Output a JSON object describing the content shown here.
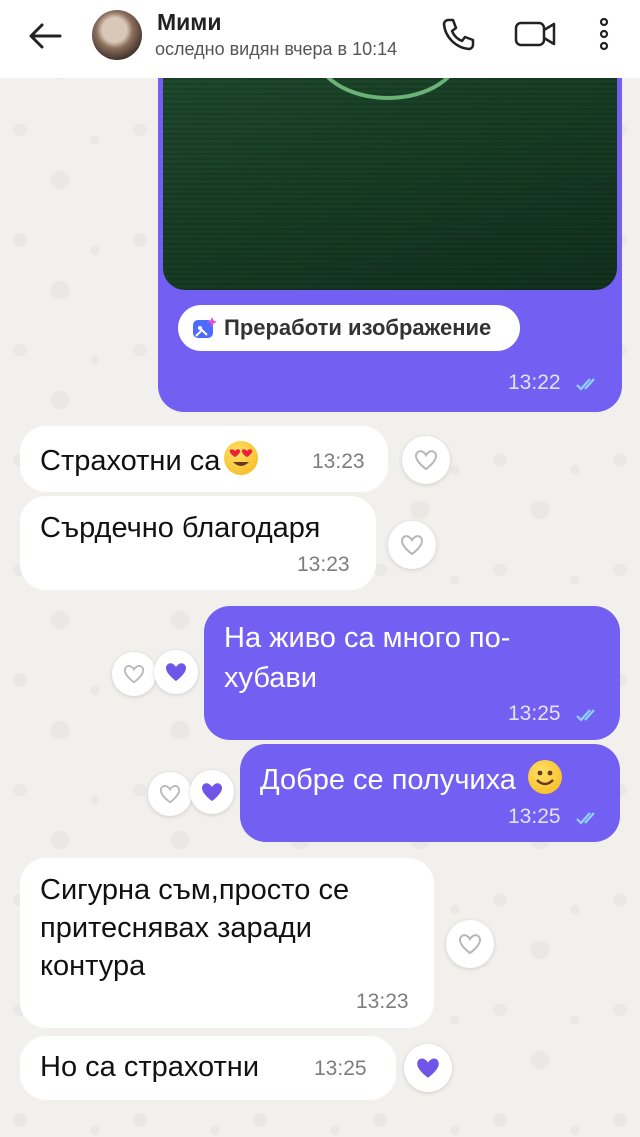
{
  "header": {
    "title": "Мими",
    "status": "оследно видян вчера в 10:14"
  },
  "messages": {
    "image_msg": {
      "action_label": "Преработи изображение",
      "time": "13:22",
      "direction": "outgoing"
    },
    "m1": {
      "text": "Страхотни са",
      "emoji": "heart-eyes-emoji",
      "time": "13:23",
      "direction": "incoming"
    },
    "m2": {
      "text": "Сърдечно благодаря",
      "time": "13:23",
      "direction": "incoming"
    },
    "m3": {
      "line1": "На живо са много по-",
      "line2": "хубави",
      "time": "13:25",
      "direction": "outgoing"
    },
    "m4": {
      "text": "Добре се получиха",
      "emoji": "smile-emoji",
      "time": "13:25",
      "direction": "outgoing"
    },
    "m5": {
      "line1": "Сигурна съм,просто се",
      "line2": "притеснявах заради",
      "line3": "контура",
      "time": "13:23",
      "direction": "incoming"
    },
    "m6": {
      "text": "Но са страхотни",
      "time": "13:25",
      "direction": "incoming",
      "liked": true
    }
  },
  "colors": {
    "outgoing_bubble": "#7360f2",
    "incoming_bubble": "#ffffff",
    "like_filled": "#6f55e8"
  }
}
